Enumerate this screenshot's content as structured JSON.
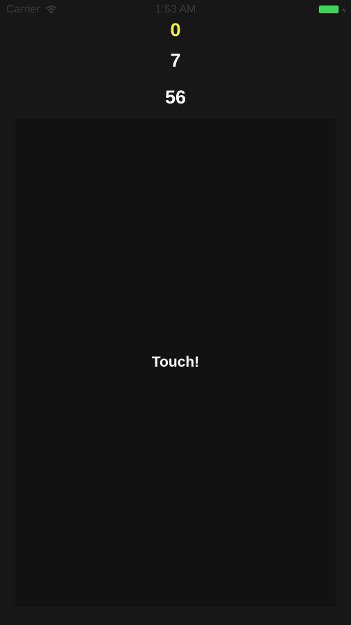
{
  "status_bar": {
    "carrier": "Carrier",
    "time": "1:53 AM",
    "battery_color": "#3fd35a",
    "icons": [
      "wifi-icon",
      "battery-icon",
      "charging-icon"
    ]
  },
  "counters": {
    "first": "0",
    "first_color": "#f3f53c",
    "second": "7",
    "third": "56"
  },
  "touch_area": {
    "label": "Touch!",
    "background": "#121212"
  },
  "background": "#171717"
}
